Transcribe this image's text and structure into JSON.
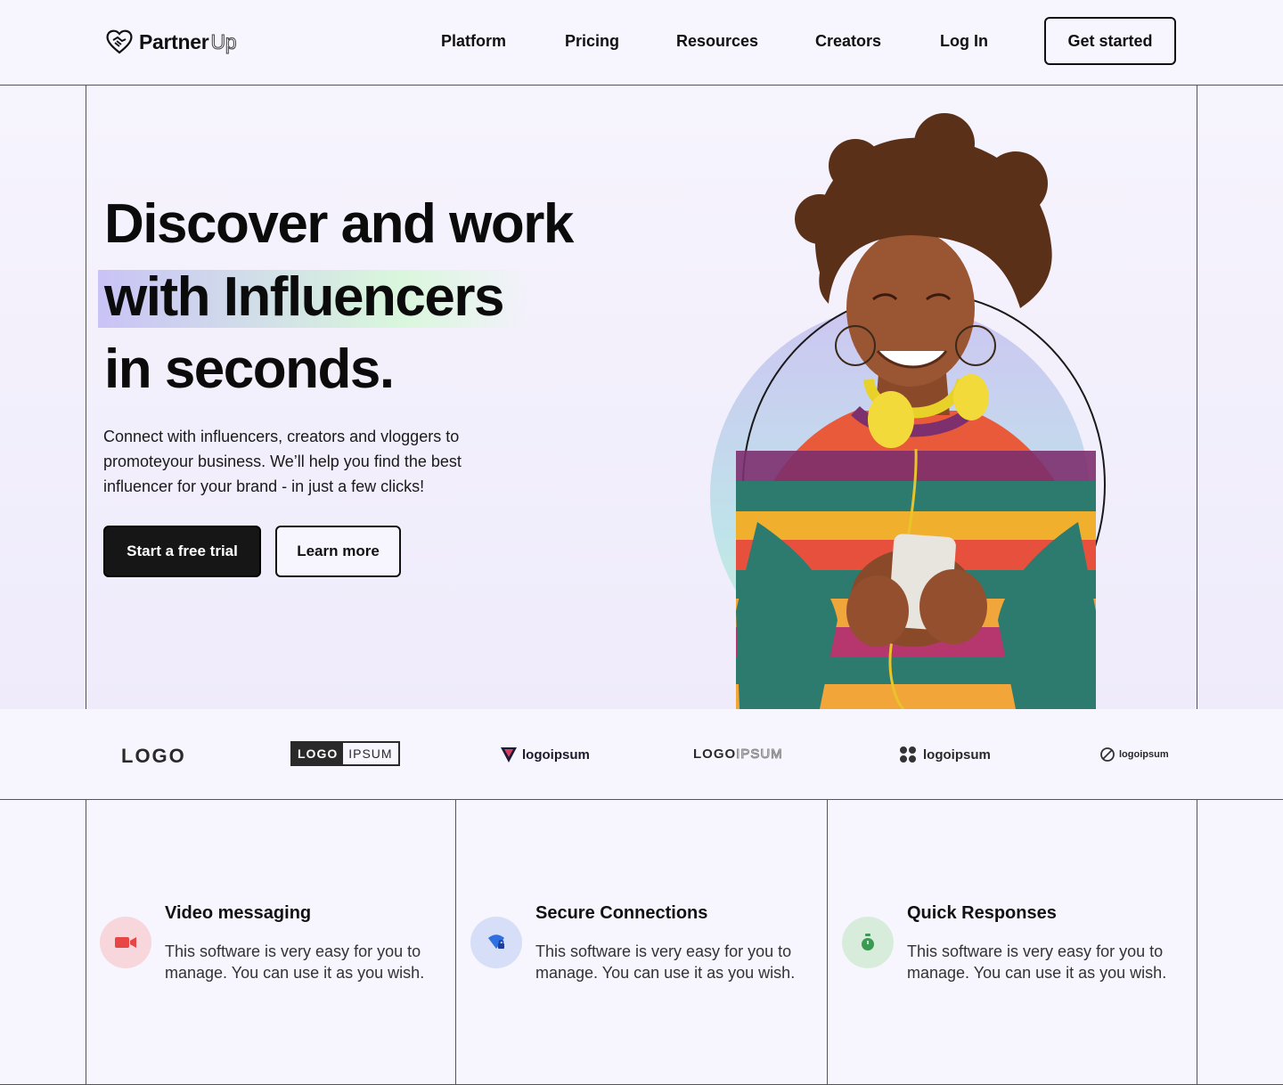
{
  "header": {
    "brand_name": "Partner",
    "brand_suffix": "Up",
    "nav": [
      "Platform",
      "Pricing",
      "Resources",
      "Creators",
      "Log In"
    ],
    "cta": "Get started"
  },
  "hero": {
    "headline_line1": "Discover and work",
    "headline_line2": "with Influencers",
    "headline_line3": "in seconds.",
    "subtitle": "Connect with influencers, creators and vloggers to promoteyour business. We’ll help you find the best influencer for your brand - in just a few clicks!",
    "primary_button": "Start a free trial",
    "secondary_button": "Learn more"
  },
  "logos": {
    "logo1": "LOGO",
    "logo2a": "LOGO",
    "logo2b": "IPSUM",
    "logo3": "logoipsum",
    "logo4a": "LOGO",
    "logo4b": "IPSUM",
    "logo5": "logoipsum",
    "logo6": "logoipsum"
  },
  "features": [
    {
      "title": "Video messaging",
      "description": "This software is very easy for you to manage. You can use it as you wish.",
      "icon": "video-camera-icon",
      "icon_color": "#e84545",
      "icon_bg": "#f7d6dc"
    },
    {
      "title": "Secure Connections",
      "description": "This software is very easy for you to manage. You can use it as you wish.",
      "icon": "secure-wifi-icon",
      "icon_color": "#2f6fe0",
      "icon_bg": "#d7def8"
    },
    {
      "title": "Quick Responses",
      "description": "This software is very easy for you to manage. You can use it as you wish.",
      "icon": "stopwatch-icon",
      "icon_color": "#3a9a52",
      "icon_bg": "#d8ecdc"
    }
  ]
}
